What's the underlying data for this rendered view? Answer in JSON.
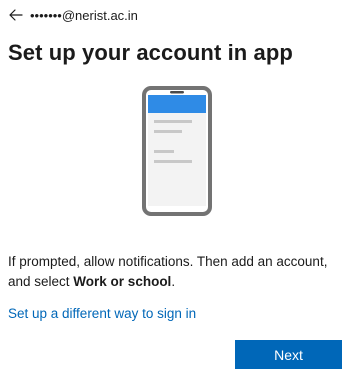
{
  "header": {
    "back_icon": "arrow-left-icon",
    "account_identity": "•••••••@nerist.ac.in"
  },
  "main": {
    "title": "Set up your account in app",
    "illustration_icon": "smartphone-icon",
    "instruction_prefix": "If prompted, allow notifications. Then add an account, and select ",
    "instruction_bold": "Work or school",
    "instruction_suffix": ".",
    "alt_link": "Set up a different way to sign in"
  },
  "footer": {
    "next_label": "Next"
  },
  "colors": {
    "accent": "#0067b8",
    "phone_frame": "#737373",
    "phone_screen_header": "#2f8be6"
  }
}
